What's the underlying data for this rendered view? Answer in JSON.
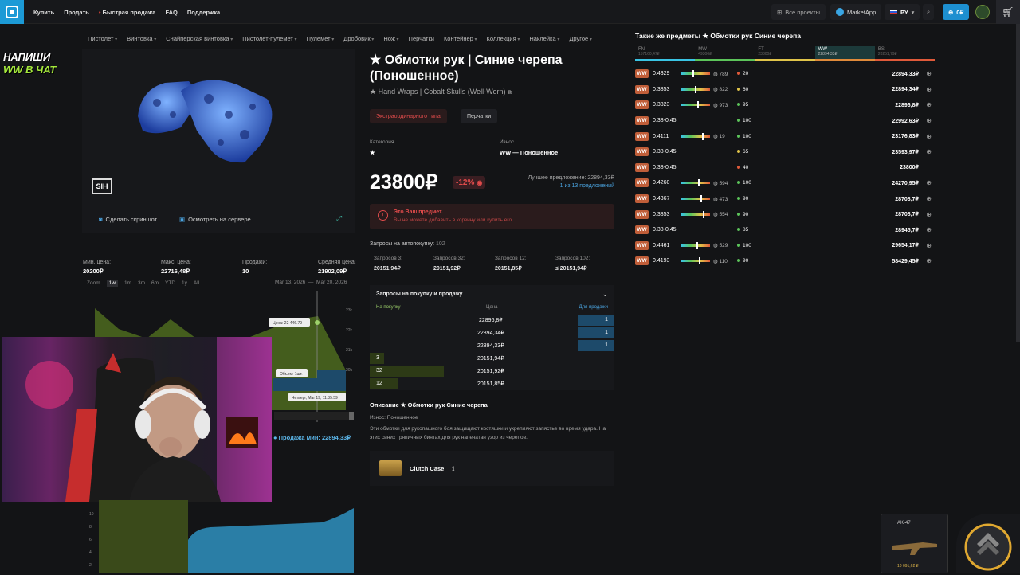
{
  "nav": {
    "items": [
      "Купить",
      "Продать",
      "Быстрая продажа",
      "FAQ",
      "Поддержка"
    ]
  },
  "topright": {
    "projects": "Все проекты",
    "marketapp": "MarketApp",
    "lang": "РУ",
    "balance": "0₽"
  },
  "categories": [
    "Пистолет",
    "Винтовка",
    "Снайперская винтовка",
    "Пистолет-пулемет",
    "Пулемет",
    "Дробовик",
    "Нож",
    "Перчатки",
    "Контейнер",
    "Коллекция",
    "Наклейка",
    "Другое"
  ],
  "promo": {
    "line1": "НАПИШИ",
    "line2": "WW В ЧАТ"
  },
  "preview": {
    "screenshot": "Сделать скриншот",
    "server": "Осмотреть на сервере"
  },
  "stats": [
    {
      "label": "Мин. цена:",
      "value": "20200₽"
    },
    {
      "label": "Макс. цена:",
      "value": "22716,48₽"
    },
    {
      "label": "Продажи:",
      "value": "10"
    },
    {
      "label": "Средняя цена:",
      "value": "21902,09₽"
    }
  ],
  "zoom": {
    "label": "Zoom",
    "options": [
      "1w",
      "1m",
      "3m",
      "6m",
      "YTD",
      "1y",
      "All"
    ],
    "active": "1w"
  },
  "dates": {
    "from": "Mar 13, 2026",
    "to": "Mar 20, 2026"
  },
  "chart_data": {
    "type": "area",
    "ylabels": [
      "23k",
      "22k",
      "21k",
      "20k"
    ],
    "tooltip_price": "Цена: 22 446.79",
    "tooltip_vol": "Объем: 1шт.",
    "tooltip_date": "Четверг, Mar 19, 11:35:59",
    "min_sale": "Продажа мин: 22894,33₽"
  },
  "chart2": {
    "ylabels": [
      "10",
      "8",
      "6",
      "4",
      "2"
    ]
  },
  "item": {
    "title": "★ Обмотки рук | Синие черепа (Поношенное)",
    "subtitle": "★ Hand Wraps | Cobalt Skulls (Well-Worn)",
    "tag1": "Экстраординарного типа",
    "tag2": "Перчатки",
    "cat_label": "Категория",
    "cat_value": "★",
    "wear_label": "Износ",
    "wear_value": "WW — Поношенное",
    "price": "23800₽",
    "discount": "-12%",
    "best_offer": "Лучшее предложение: 22894,33₽",
    "offers_link": "1 из 13 предложений"
  },
  "alert": {
    "title": "Это Ваш предмет.",
    "text": "Вы не можете добавить в корзину или купить его"
  },
  "autobuy": {
    "label": "Запросы на автопокупку:",
    "count": "102",
    "cols": [
      {
        "l": "Запросов 3:",
        "v": "20151,94₽"
      },
      {
        "l": "Запросов 32:",
        "v": "20151,92₽"
      },
      {
        "l": "Запросов 12:",
        "v": "20151,85₽"
      },
      {
        "l": "Запросов 102:",
        "v": "≤ 20151,94₽"
      }
    ]
  },
  "orders": {
    "title": "Запросы на покупку и продажу",
    "buy": "На покупку",
    "price": "Цена",
    "sell": "Для продажи",
    "rows": [
      {
        "b": "",
        "p": "22896,8₽",
        "s": "1"
      },
      {
        "b": "",
        "p": "22894,34₽",
        "s": "1"
      },
      {
        "b": "",
        "p": "22894,33₽",
        "s": "1"
      },
      {
        "b": "3",
        "p": "20151,94₽",
        "s": ""
      },
      {
        "b": "32",
        "p": "20151,92₽",
        "s": ""
      },
      {
        "b": "12",
        "p": "20151,85₽",
        "s": ""
      }
    ]
  },
  "description": {
    "title": "Описание ★ Обмотки рук Синие черепа",
    "wear": "Износ: Поношенное",
    "text": "Эти обмотки для рукопашного боя защищают костяшки и укрепляют запястье во время удара. На этих синих тряпичных бинтах для рук напечатан узор из черепов."
  },
  "case": {
    "name": "Clutch Case"
  },
  "similar": {
    "title": "Такие же предметы ★ Обмотки рук Синие черепа",
    "tabs": [
      {
        "n": "FN",
        "p": "157160,47₽"
      },
      {
        "n": "MW",
        "p": "49300₽"
      },
      {
        "n": "FT",
        "p": "23300₽"
      },
      {
        "n": "WW",
        "p": "22894,33₽"
      },
      {
        "n": "BS",
        "p": "20251,79₽"
      }
    ],
    "rows": [
      {
        "f": "0.4329",
        "st": "789",
        "pc": "20",
        "c": "#e05a3a",
        "pr": "22894,33₽"
      },
      {
        "f": "0.3853",
        "st": "822",
        "pc": "60",
        "c": "#e0c44a",
        "pr": "22894,34₽"
      },
      {
        "f": "0.3823",
        "st": "973",
        "pc": "95",
        "c": "#5cc45a",
        "pr": "22896,8₽"
      },
      {
        "f": "0.38-0.45",
        "st": "",
        "pc": "100",
        "c": "#5cc45a",
        "pr": "22992,63₽"
      },
      {
        "f": "0.4111",
        "st": "19",
        "pc": "100",
        "c": "#5cc45a",
        "pr": "23176,83₽"
      },
      {
        "f": "0.38-0.45",
        "st": "",
        "pc": "65",
        "c": "#e0c44a",
        "pr": "23593,97₽"
      },
      {
        "f": "0.38-0.45",
        "st": "",
        "pc": "40",
        "c": "#e05a3a",
        "pr": "23800₽"
      },
      {
        "f": "0.4260",
        "st": "594",
        "pc": "100",
        "c": "#5cc45a",
        "pr": "24270,95₽"
      },
      {
        "f": "0.4367",
        "st": "473",
        "pc": "90",
        "c": "#5cc45a",
        "pr": "28708,7₽"
      },
      {
        "f": "0.3853",
        "st": "554",
        "pc": "90",
        "c": "#5cc45a",
        "pr": "28708,7₽"
      },
      {
        "f": "0.38-0.45",
        "st": "",
        "pc": "85",
        "c": "#5cc45a",
        "pr": "28945,7₽"
      },
      {
        "f": "0.4461",
        "st": "529",
        "pc": "100",
        "c": "#5cc45a",
        "pr": "29654,17₽"
      },
      {
        "f": "0.4193",
        "st": "110",
        "pc": "90",
        "c": "#5cc45a",
        "pr": "58429,45₽"
      }
    ]
  },
  "overlay": {
    "name": "AK-47",
    "price": "10 091,62 ₽"
  }
}
